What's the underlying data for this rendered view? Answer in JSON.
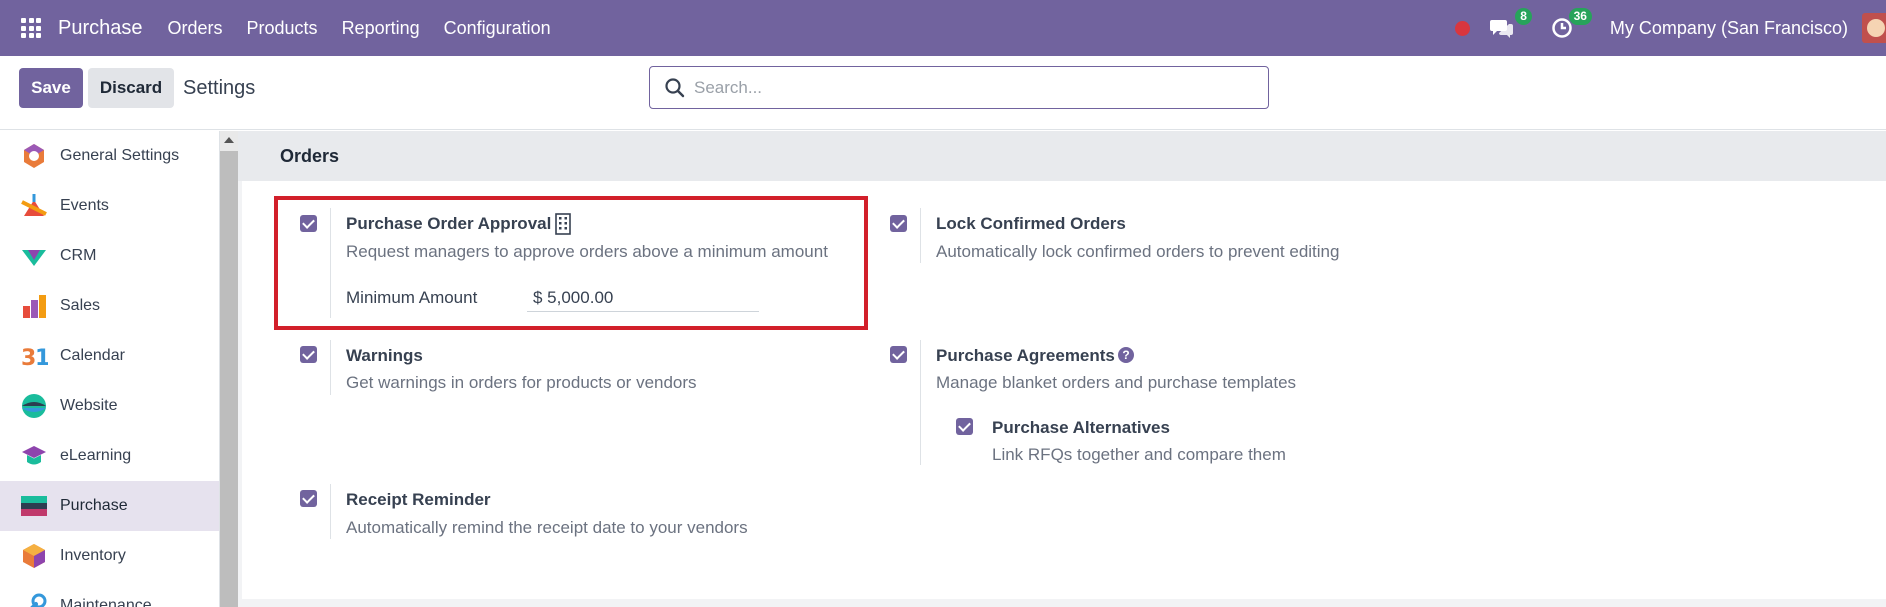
{
  "topbar": {
    "app_name": "Purchase",
    "menu": [
      "Orders",
      "Products",
      "Reporting",
      "Configuration"
    ],
    "messages_count": "8",
    "activities_count": "36",
    "company": "My Company (San Francisco)"
  },
  "control": {
    "save_label": "Save",
    "discard_label": "Discard",
    "title": "Settings",
    "search_placeholder": "Search..."
  },
  "sidebar": {
    "items": [
      {
        "label": "General Settings",
        "icon": "general-settings-icon"
      },
      {
        "label": "Events",
        "icon": "events-icon"
      },
      {
        "label": "CRM",
        "icon": "crm-icon"
      },
      {
        "label": "Sales",
        "icon": "sales-icon"
      },
      {
        "label": "Calendar",
        "icon": "calendar-icon"
      },
      {
        "label": "Website",
        "icon": "website-icon"
      },
      {
        "label": "eLearning",
        "icon": "elearning-icon"
      },
      {
        "label": "Purchase",
        "icon": "purchase-icon",
        "active": true
      },
      {
        "label": "Inventory",
        "icon": "inventory-icon"
      },
      {
        "label": "Maintenance",
        "icon": "maintenance-icon"
      }
    ]
  },
  "section": {
    "title": "Orders",
    "settings": {
      "po_approval": {
        "title": "Purchase Order Approval",
        "desc": "Request managers to approve orders above a minimum amount",
        "min_label": "Minimum Amount",
        "min_value": "$ 5,000.00",
        "checked": true
      },
      "lock_orders": {
        "title": "Lock Confirmed Orders",
        "desc": "Automatically lock confirmed orders to prevent editing",
        "checked": true
      },
      "warnings": {
        "title": "Warnings",
        "desc": "Get warnings in orders for products or vendors",
        "checked": true
      },
      "agreements": {
        "title": "Purchase Agreements",
        "desc": "Manage blanket orders and purchase templates",
        "checked": true
      },
      "alternatives": {
        "title": "Purchase Alternatives",
        "desc": "Link RFQs together and compare them",
        "checked": true
      },
      "receipt": {
        "title": "Receipt Reminder",
        "desc": "Automatically remind the receipt date to your vendors",
        "checked": true
      }
    }
  },
  "colors": {
    "brand": "#71639e",
    "highlight": "#d21f2a",
    "badge": "#27a35b"
  }
}
